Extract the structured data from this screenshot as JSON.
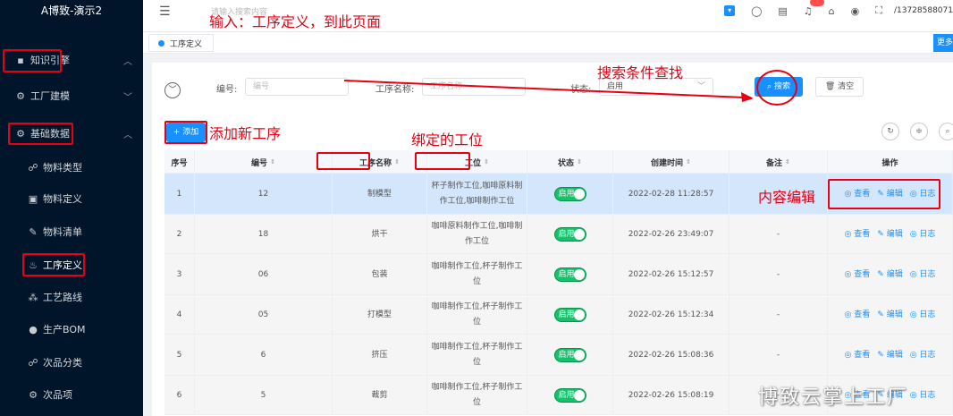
{
  "app": {
    "title": "A博致-演示2"
  },
  "header": {
    "search_placeholder": "请输入搜索内容",
    "user": "/13728588071"
  },
  "annotations": {
    "input_note": "输入：工序定义，到此页面",
    "search_note": "搜索条件查找",
    "add_note": "添加新工序",
    "station_note": "绑定的工位",
    "edit_note": "内容编辑"
  },
  "sidebar": {
    "items": [
      {
        "label": "知识引擎",
        "icon": "book-icon",
        "level": 1
      },
      {
        "label": "工厂建模",
        "icon": "gear-icon",
        "level": 1
      },
      {
        "label": "基础数据",
        "icon": "gear-icon",
        "level": 1
      },
      {
        "label": "物料类型",
        "icon": "people-icon",
        "level": 2
      },
      {
        "label": "物料定义",
        "icon": "doc-icon",
        "level": 2
      },
      {
        "label": "物料清单",
        "icon": "edit-icon",
        "level": 2
      },
      {
        "label": "工序定义",
        "icon": "process-icon",
        "level": 2
      },
      {
        "label": "工艺路线",
        "icon": "route-icon",
        "level": 2
      },
      {
        "label": "生产BOM",
        "icon": "bom-icon",
        "level": 2
      },
      {
        "label": "次品分类",
        "icon": "people-icon",
        "level": 2
      },
      {
        "label": "次品项",
        "icon": "gear-icon",
        "level": 2
      }
    ]
  },
  "tabs": {
    "active": "工序定义",
    "more": "更多"
  },
  "search": {
    "code_label": "编号:",
    "code_placeholder": "编号",
    "name_label": "工序名称:",
    "name_placeholder": "工序名称",
    "status_label": "状态:",
    "status_value": "启用",
    "search_btn": "搜索",
    "clear_btn": "清空"
  },
  "toolbar": {
    "add_btn": "+ 添加"
  },
  "table": {
    "columns": [
      "序号",
      "编号",
      "工序名称",
      "工位",
      "状态",
      "创建时间",
      "备注",
      "操作"
    ],
    "rows": [
      {
        "no": "1",
        "code": "12",
        "name": "制模型",
        "station": "杯子制作工位,咖啡原料制作工位,咖啡制作工位",
        "status": "启用",
        "created": "2022-02-28 11:28:57",
        "remark": ""
      },
      {
        "no": "2",
        "code": "18",
        "name": "烘干",
        "station": "咖啡原料制作工位,咖啡制作工位",
        "status": "启用",
        "created": "2022-02-26 23:49:07",
        "remark": "-"
      },
      {
        "no": "3",
        "code": "06",
        "name": "包装",
        "station": "咖啡制作工位,杯子制作工位",
        "status": "启用",
        "created": "2022-02-26 15:12:57",
        "remark": "-"
      },
      {
        "no": "4",
        "code": "05",
        "name": "打模型",
        "station": "咖啡制作工位,杯子制作工位",
        "status": "启用",
        "created": "2022-02-26 15:12:34",
        "remark": "-"
      },
      {
        "no": "5",
        "code": "6",
        "name": "挤压",
        "station": "咖啡制作工位,杯子制作工位",
        "status": "启用",
        "created": "2022-02-26 15:08:36",
        "remark": "-"
      },
      {
        "no": "6",
        "code": "5",
        "name": "裁剪",
        "station": "咖啡制作工位,杯子制作工位",
        "status": "启用",
        "created": "2022-02-26 15:08:19",
        "remark": "-"
      }
    ],
    "ops": {
      "view": "查看",
      "edit": "编辑",
      "log": "日志"
    }
  },
  "watermark": "博致云掌上工厂",
  "colors": {
    "primary": "#1890ff",
    "annotation": "#e60012",
    "sidebar": "#001529",
    "status_on": "#13c26b"
  }
}
